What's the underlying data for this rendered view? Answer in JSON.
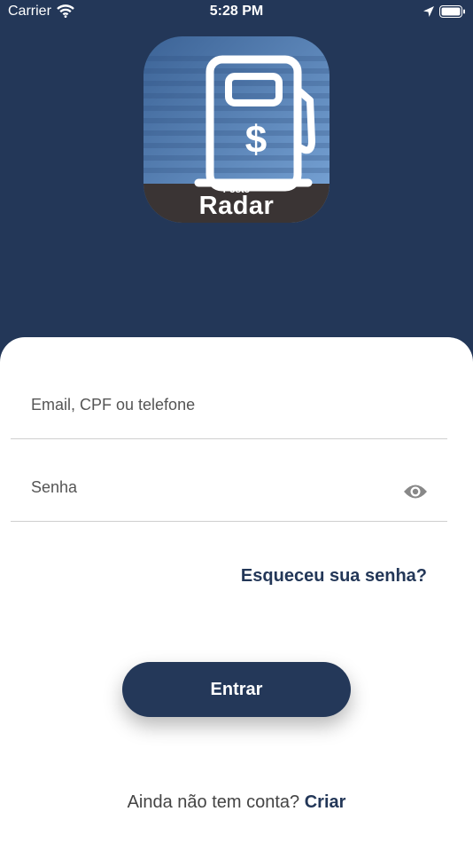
{
  "status_bar": {
    "carrier": "Carrier",
    "time": "5:28 PM"
  },
  "app_icon": {
    "label_small": "Posto",
    "label_big": "Radar",
    "symbol": "$"
  },
  "login": {
    "email_placeholder": "Email, CPF ou telefone",
    "password_placeholder": "Senha",
    "forgot_label": "Esqueceu sua senha?",
    "submit_label": "Entrar",
    "signup_prompt": "Ainda não tem conta?",
    "signup_link": "Criar"
  },
  "colors": {
    "brand_navy": "#233758",
    "sheet_white": "#ffffff",
    "icon_gray": "#888888"
  },
  "icons": {
    "password_toggle": "eye-icon",
    "location": "location-arrow-icon",
    "wifi": "wifi-icon",
    "battery": "battery-icon"
  }
}
